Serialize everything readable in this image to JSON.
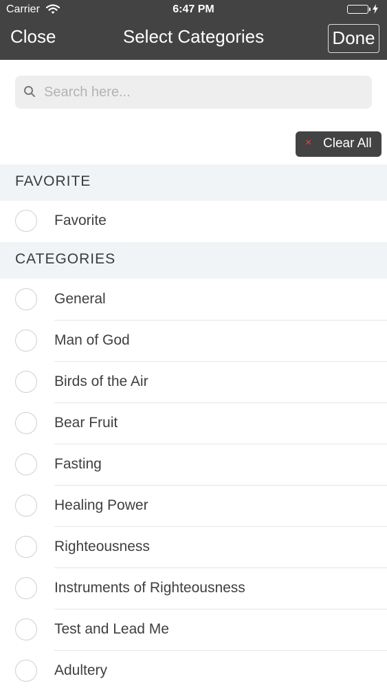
{
  "status_bar": {
    "carrier": "Carrier",
    "time": "6:47 PM",
    "battery_color": "#4cd964"
  },
  "nav": {
    "close_label": "Close",
    "title": "Select Categories",
    "done_label": "Done"
  },
  "search": {
    "placeholder": "Search here...",
    "value": ""
  },
  "clear_all": {
    "label": "Clear All",
    "icon_char": "×",
    "icon_color": "#e04848"
  },
  "sections": [
    {
      "header": "FAVORITE",
      "items": [
        "Favorite"
      ]
    },
    {
      "header": "CATEGORIES",
      "items": [
        "General",
        "Man of God",
        "Birds of the Air",
        "Bear Fruit",
        "Fasting",
        "Healing Power",
        "Righteousness",
        "Instruments of Righteousness",
        "Test and Lead Me",
        "Adultery"
      ]
    }
  ],
  "colors": {
    "nav_bar": "#434343",
    "section_bg": "#f1f4f6",
    "search_bg": "#efeeef"
  }
}
